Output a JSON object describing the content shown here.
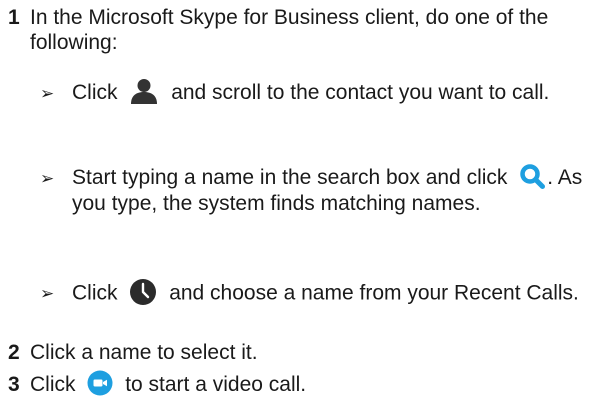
{
  "steps": [
    {
      "number": "1",
      "text": "In the Microsoft Skype for Business client, do one of the following:",
      "options": [
        {
          "before": "Click",
          "icon": "contact-person-icon",
          "after": "and scroll to the contact you want to call."
        },
        {
          "before": "Start typing a name in the search box and click",
          "icon": "search-magnifier-icon",
          "after": ". As you type, the system finds matching names."
        },
        {
          "before": "Click",
          "icon": "clock-icon",
          "after": "and choose a name from your Recent Calls."
        }
      ]
    },
    {
      "number": "2",
      "text": "Click a name to select it."
    },
    {
      "number": "3",
      "before": "Click",
      "icon": "video-camera-icon",
      "after": "to start a video call."
    }
  ],
  "bullet_glyph": "➢",
  "colors": {
    "text": "#1a1a1a",
    "person_icon": "#333333",
    "search_icon": "#1e9fe0",
    "clock_icon": "#2b2b2b",
    "video_icon": "#1e9fe0"
  }
}
